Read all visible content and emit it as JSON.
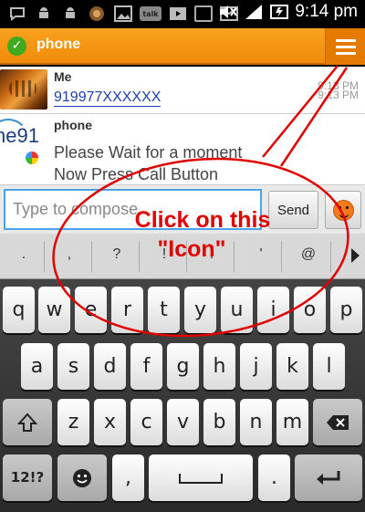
{
  "status_bar": {
    "time": "9:14 pm",
    "left_icons": [
      "sms-icon",
      "android-icon",
      "android-icon",
      "badge-icon",
      "image-icon",
      "talk-icon",
      "video-icon",
      "box-icon",
      "email-icon"
    ],
    "talk_label": "talk",
    "right_icons": [
      "mute-icon",
      "signal-icon",
      "battery-icon"
    ]
  },
  "action_bar": {
    "title": "phone"
  },
  "messages": [
    {
      "sender": "Me",
      "body": "919977XXXXXX",
      "time": "9:13 PM"
    },
    {
      "sender": "phone",
      "body_line1": "Please Wait for a moment",
      "body_line2": "Now Press Call Button",
      "time": "9:13 PM"
    }
  ],
  "avatar_logo_text": "ne91",
  "compose": {
    "placeholder": "Type to compose",
    "send_label": "Send"
  },
  "keyboard": {
    "suggestions": [
      ".",
      ",",
      "?",
      "!",
      ":",
      "'",
      "@"
    ],
    "row1": [
      "q",
      "w",
      "e",
      "r",
      "t",
      "y",
      "u",
      "i",
      "o",
      "p"
    ],
    "row2": [
      "a",
      "s",
      "d",
      "f",
      "g",
      "h",
      "j",
      "k",
      "l"
    ],
    "row3": [
      "z",
      "x",
      "c",
      "v",
      "b",
      "n",
      "m"
    ],
    "row4": {
      "mode": "12!?",
      "comma": ",",
      "period": "."
    }
  },
  "annotation": {
    "line1": "Click on this",
    "line2": "\"Icon\"",
    "color": "#e00000"
  },
  "colors": {
    "action_bar": "#f39a12",
    "link": "#1f3fae",
    "input_border": "#4aa3e8"
  }
}
